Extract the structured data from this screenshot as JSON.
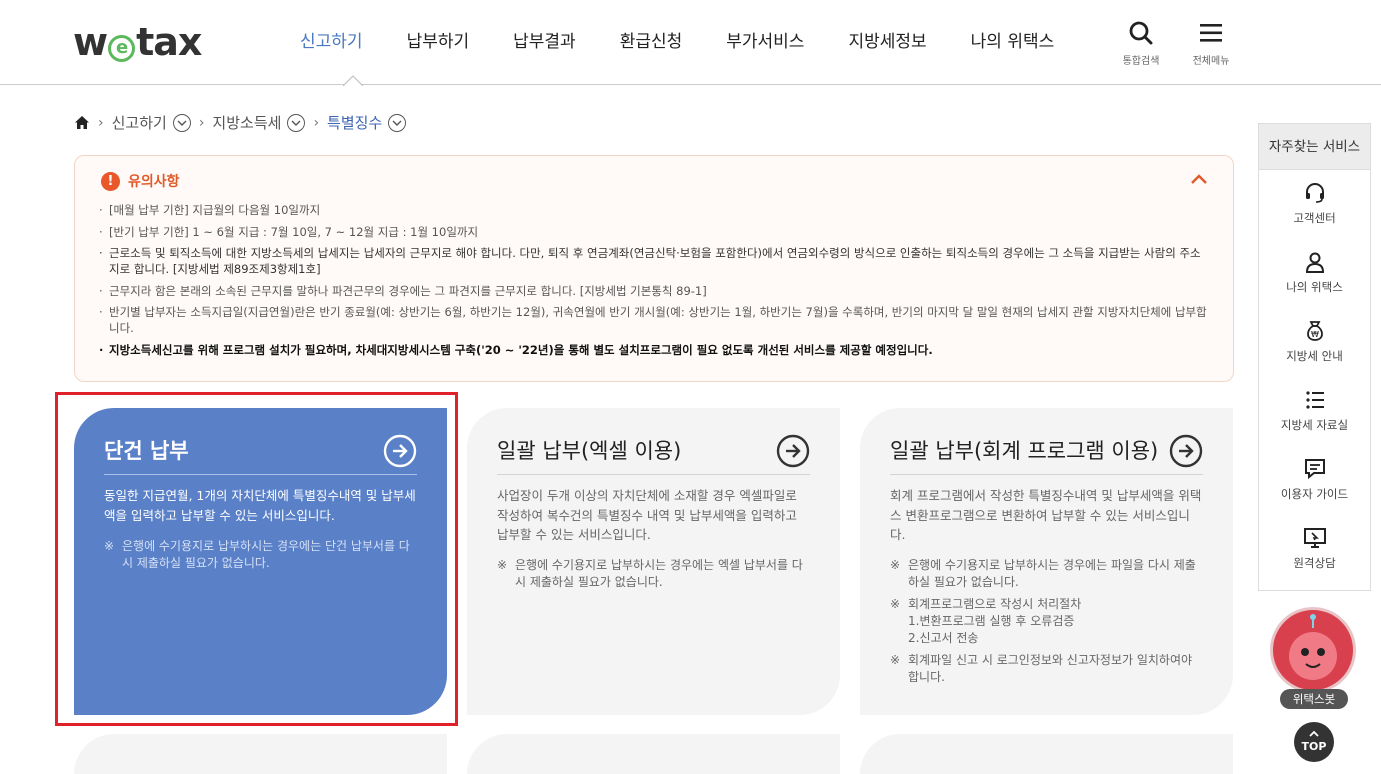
{
  "header": {
    "logo": {
      "w": "w",
      "e": "e",
      "tax": "tax"
    },
    "nav": [
      "신고하기",
      "납부하기",
      "납부결과",
      "환급신청",
      "부가서비스",
      "지방세정보",
      "나의 위택스"
    ],
    "search_label": "통합검색",
    "menu_label": "전체메뉴"
  },
  "breadcrumb": [
    "신고하기",
    "지방소득세",
    "특별징수"
  ],
  "notice": {
    "title": "유의사항",
    "items": [
      "[매월 납부 기한] 지급월의 다음월 10일까지",
      "[반기 납부 기한] 1 ~ 6월 지급 : 7월 10일, 7 ~ 12월 지급 : 1월 10일까지",
      "근로소득 및 퇴직소득에 대한 지방소득세의 납세지는 납세자의 근무지로 해야 합니다. 다만, 퇴직 후 연금계좌(연금신탁·보험을 포함한다)에서 연금외수령의 방식으로 인출하는 퇴직소득의 경우에는 그 소득을 지급받는 사람의 주소지로 합니다. [지방세법 제89조제3항제1호]",
      "근무지라 함은 본래의 소속된 근무지를 말하나 파견근무의 경우에는 그 파견지를 근무지로 합니다. [지방세법 기본통칙 89-1]",
      "반기별 납부자는 소득지급일(지급연월)란은 반기 종료월(예: 상반기는 6월, 하반기는 12월), 귀속연월에 반기 개시월(예: 상반기는 1월, 하반기는 7월)을 수록하며, 반기의 마지막 달 말일 현재의 납세지 관할 지방자치단체에 납부합니다.",
      "지방소득세신고를 위해 프로그램 설치가 필요하며, 차세대지방세시스템 구축('20 ~ '22년)을 통해 별도 설치프로그램이 필요 없도록 개선된 서비스를 제공할 예정입니다."
    ]
  },
  "cards": [
    {
      "title": "단건 납부",
      "desc": "동일한 지급연월, 1개의 자치단체에 특별징수내역 및 납부세액을 입력하고 납부할 수 있는 서비스입니다.",
      "notes": [
        "은행에 수기용지로 납부하시는 경우에는 단건 납부서를 다시 제출하실 필요가 없습니다."
      ]
    },
    {
      "title": "일괄 납부(엑셀 이용)",
      "desc": "사업장이 두개 이상의 자치단체에 소재할 경우 엑셀파일로 작성하여 복수건의 특별징수 내역 및 납부세액을 입력하고 납부할 수 있는 서비스입니다.",
      "notes": [
        "은행에 수기용지로 납부하시는 경우에는 엑셀 납부서를 다시 제출하실 필요가 없습니다."
      ]
    },
    {
      "title": "일괄 납부(회계 프로그램 이용)",
      "desc": "회계 프로그램에서 작성한 특별징수내역 및 납부세액을 위택스 변환프로그램으로 변환하여 납부할 수 있는 서비스입니다.",
      "notes": [
        "은행에 수기용지로 납부하시는 경우에는 파일을 다시 제출하실 필요가 없습니다.",
        "회계프로그램으로 작성시 처리절차\n1.변환프로그램 실행 후 오류검증\n2.신고서 전송",
        "회계파일 신고 시 로그인정보와 신고자정보가 일치하여야 합니다."
      ]
    }
  ],
  "quick_menu": {
    "title": "자주찾는 서비스",
    "items": [
      "고객센터",
      "나의 위택스",
      "지방세 안내",
      "지방세 자료실",
      "이용자 가이드",
      "원격상담"
    ]
  },
  "bot_label": "위택스봇",
  "top_label": "TOP",
  "colors": {
    "accent": "#4a78c2",
    "card_blue": "#5a80c8",
    "alert": "#e8582a",
    "highlight": "#e0202a"
  }
}
